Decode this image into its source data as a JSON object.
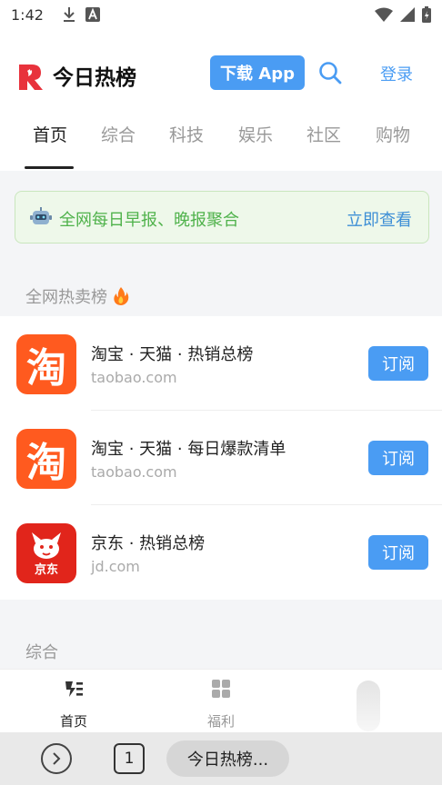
{
  "status_bar": {
    "time": "1:42",
    "icons": [
      "download-icon",
      "a-badge-icon",
      "wifi-icon",
      "signal-icon",
      "battery-icon"
    ]
  },
  "header": {
    "brand": "今日热榜",
    "download_label": "下载 App",
    "login_label": "登录",
    "accent": "#4a9cf3",
    "logo_color": "#e8323c"
  },
  "tabs": [
    {
      "label": "首页",
      "active": true
    },
    {
      "label": "综合",
      "active": false
    },
    {
      "label": "科技",
      "active": false
    },
    {
      "label": "娱乐",
      "active": false
    },
    {
      "label": "社区",
      "active": false
    },
    {
      "label": "购物",
      "active": false
    }
  ],
  "banner": {
    "icon": "robot-icon",
    "text": "全网每日早报、晚报聚合",
    "action": "立即查看",
    "text_color": "#4fb24b"
  },
  "sections": {
    "hot_sales_title": "全网热卖榜",
    "hot_sales_icon": "fire-icon",
    "general_title": "综合"
  },
  "hot_list": [
    {
      "title": "淘宝 · 天猫 · 热销总榜",
      "domain": "taobao.com",
      "icon_char": "淘",
      "icon_bg": "#ff5a1f",
      "button": "订阅"
    },
    {
      "title": "淘宝 · 天猫 · 每日爆款清单",
      "domain": "taobao.com",
      "icon_char": "淘",
      "icon_bg": "#ff5a1f",
      "button": "订阅"
    },
    {
      "title": "京东 · 热销总榜",
      "domain": "jd.com",
      "icon_char": "京东",
      "icon_bg": "#e1251b",
      "button": "订阅"
    }
  ],
  "bottom_nav": [
    {
      "label": "首页",
      "icon": "home-bolt-icon",
      "active": true
    },
    {
      "label": "福利",
      "icon": "grid-icon",
      "active": false
    }
  ],
  "browser": {
    "tab_count": "1",
    "page_title": "今日热榜..."
  }
}
